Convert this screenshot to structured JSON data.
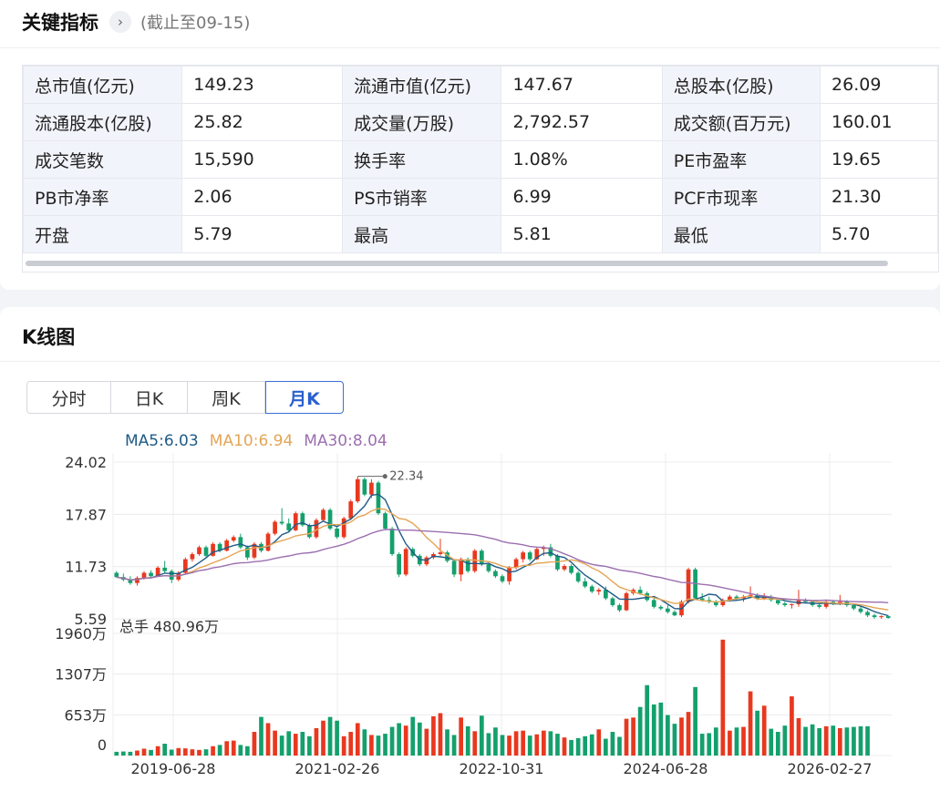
{
  "header": {
    "title": "关键指标",
    "subtitle": "(截止至09-15)"
  },
  "metrics": [
    [
      {
        "label": "总市值(亿元)",
        "value": "149.23"
      },
      {
        "label": "流通市值(亿元)",
        "value": "147.67"
      },
      {
        "label": "总股本(亿股)",
        "value": "26.09"
      }
    ],
    [
      {
        "label": "流通股本(亿股)",
        "value": "25.82"
      },
      {
        "label": "成交量(万股)",
        "value": "2,792.57"
      },
      {
        "label": "成交额(百万元)",
        "value": "160.01"
      }
    ],
    [
      {
        "label": "成交笔数",
        "value": "15,590"
      },
      {
        "label": "换手率",
        "value": "1.08%"
      },
      {
        "label": "PE市盈率",
        "value": "19.65"
      }
    ],
    [
      {
        "label": "PB市净率",
        "value": "2.06"
      },
      {
        "label": "PS市销率",
        "value": "6.99"
      },
      {
        "label": "PCF市现率",
        "value": "21.30"
      }
    ],
    [
      {
        "label": "开盘",
        "value": "5.79"
      },
      {
        "label": "最高",
        "value": "5.81"
      },
      {
        "label": "最低",
        "value": "5.70"
      }
    ]
  ],
  "kline": {
    "title": "K线图",
    "tabs": [
      "分时",
      "日K",
      "周K",
      "月K"
    ],
    "active_tab": "月K"
  },
  "colors": {
    "up": "#e8381f",
    "down": "#14a06c",
    "ma5": "#1f5b87",
    "ma10": "#e4a556",
    "ma30": "#9b6fb0",
    "accent": "#2a5fcf"
  },
  "chart_data": {
    "type": "candlestick",
    "ma_legend": [
      {
        "name": "MA5",
        "label": "MA5:6.03",
        "color": "#1f5b87"
      },
      {
        "name": "MA10",
        "label": "MA10:6.94",
        "color": "#e4a556"
      },
      {
        "name": "MA30",
        "label": "MA30:8.04",
        "color": "#9b6fb0"
      }
    ],
    "price_ticks": [
      "24.02",
      "17.87",
      "11.73",
      "5.59"
    ],
    "price_ylim": [
      5.59,
      24.02
    ],
    "volume_label": "总手 480.96万",
    "volume_ticks": [
      "1960万",
      "1307万",
      "653万",
      "0"
    ],
    "volume_ylim": [
      0,
      1960
    ],
    "x_ticks": [
      "2019-06-28",
      "2021-02-26",
      "2022-10-31",
      "2024-06-28",
      "2026-02-27"
    ],
    "max_annotation": "22.34",
    "ohlc": [
      [
        11.0,
        11.2,
        10.4,
        10.5
      ],
      [
        10.5,
        10.9,
        10.0,
        10.2
      ],
      [
        10.2,
        10.6,
        9.6,
        9.8
      ],
      [
        9.8,
        10.6,
        9.5,
        10.4
      ],
      [
        10.4,
        11.2,
        10.2,
        11.0
      ],
      [
        11.0,
        11.3,
        10.4,
        10.6
      ],
      [
        10.6,
        11.8,
        10.5,
        11.6
      ],
      [
        11.6,
        12.4,
        11.0,
        11.2
      ],
      [
        11.2,
        11.4,
        9.8,
        10.2
      ],
      [
        10.2,
        11.2,
        10.0,
        11.0
      ],
      [
        11.0,
        12.8,
        10.9,
        12.6
      ],
      [
        12.6,
        13.4,
        12.3,
        13.2
      ],
      [
        13.2,
        14.2,
        13.0,
        14.0
      ],
      [
        14.0,
        14.2,
        12.8,
        13.0
      ],
      [
        13.0,
        14.6,
        12.9,
        14.4
      ],
      [
        14.4,
        14.6,
        13.4,
        13.6
      ],
      [
        13.6,
        15.0,
        13.5,
        14.8
      ],
      [
        14.8,
        15.4,
        14.6,
        15.2
      ],
      [
        15.2,
        15.6,
        13.8,
        14.0
      ],
      [
        14.0,
        14.2,
        12.5,
        12.8
      ],
      [
        12.8,
        14.6,
        12.6,
        14.4
      ],
      [
        14.4,
        14.6,
        13.4,
        13.6
      ],
      [
        13.6,
        15.8,
        13.5,
        15.6
      ],
      [
        15.6,
        17.2,
        15.4,
        17.0
      ],
      [
        17.0,
        18.6,
        16.6,
        16.8
      ],
      [
        16.8,
        17.4,
        15.8,
        16.0
      ],
      [
        16.0,
        18.2,
        15.9,
        18.0
      ],
      [
        18.0,
        18.2,
        16.4,
        16.6
      ],
      [
        16.6,
        16.8,
        15.0,
        15.2
      ],
      [
        15.2,
        17.4,
        15.0,
        17.2
      ],
      [
        17.2,
        18.6,
        17.0,
        18.4
      ],
      [
        18.4,
        18.6,
        16.0,
        16.2
      ],
      [
        16.2,
        16.4,
        15.0,
        15.2
      ],
      [
        15.2,
        17.6,
        15.0,
        17.4
      ],
      [
        17.4,
        19.6,
        17.2,
        19.4
      ],
      [
        19.4,
        22.34,
        19.2,
        22.0
      ],
      [
        22.0,
        22.2,
        20.0,
        20.2
      ],
      [
        20.2,
        22.0,
        19.8,
        21.6
      ],
      [
        21.6,
        21.8,
        17.8,
        18.0
      ],
      [
        18.0,
        18.2,
        16.0,
        16.2
      ],
      [
        16.2,
        16.4,
        13.0,
        13.2
      ],
      [
        13.2,
        13.4,
        10.5,
        10.8
      ],
      [
        10.8,
        14.0,
        10.6,
        13.8
      ],
      [
        13.8,
        14.0,
        12.8,
        13.0
      ],
      [
        13.0,
        13.2,
        11.8,
        12.0
      ],
      [
        12.0,
        13.0,
        11.8,
        12.8
      ],
      [
        12.8,
        13.4,
        12.6,
        13.2
      ],
      [
        13.2,
        15.0,
        13.0,
        13.4
      ],
      [
        13.4,
        13.6,
        12.2,
        12.4
      ],
      [
        12.4,
        12.6,
        10.5,
        10.8
      ],
      [
        10.8,
        12.8,
        10.0,
        12.6
      ],
      [
        12.6,
        12.8,
        11.0,
        11.2
      ],
      [
        11.2,
        13.8,
        11.0,
        13.6
      ],
      [
        13.6,
        13.8,
        11.8,
        12.0
      ],
      [
        12.0,
        12.2,
        11.0,
        11.2
      ],
      [
        11.2,
        11.4,
        10.4,
        10.6
      ],
      [
        10.6,
        10.8,
        9.8,
        10.0
      ],
      [
        10.0,
        11.8,
        9.6,
        11.6
      ],
      [
        11.6,
        12.8,
        11.4,
        12.6
      ],
      [
        12.6,
        13.6,
        12.2,
        13.4
      ],
      [
        13.4,
        13.6,
        12.4,
        12.6
      ],
      [
        12.6,
        14.0,
        12.5,
        13.8
      ],
      [
        13.8,
        14.2,
        13.0,
        14.0
      ],
      [
        14.0,
        14.4,
        12.8,
        13.0
      ],
      [
        13.0,
        13.2,
        11.2,
        11.4
      ],
      [
        11.4,
        12.0,
        11.2,
        11.8
      ],
      [
        11.8,
        12.0,
        10.8,
        11.0
      ],
      [
        11.0,
        11.2,
        9.8,
        10.0
      ],
      [
        10.0,
        10.4,
        9.2,
        9.4
      ],
      [
        9.4,
        9.6,
        8.6,
        8.8
      ],
      [
        8.8,
        9.2,
        8.4,
        9.0
      ],
      [
        9.0,
        9.4,
        7.8,
        8.0
      ],
      [
        8.0,
        8.2,
        7.0,
        7.2
      ],
      [
        7.2,
        7.4,
        6.4,
        6.6
      ],
      [
        6.6,
        8.8,
        6.5,
        8.6
      ],
      [
        8.6,
        9.2,
        8.4,
        9.0
      ],
      [
        9.0,
        9.4,
        8.4,
        8.6
      ],
      [
        8.6,
        8.8,
        7.6,
        7.8
      ],
      [
        7.8,
        8.0,
        6.8,
        7.0
      ],
      [
        7.0,
        7.2,
        6.6,
        6.8
      ],
      [
        6.8,
        7.2,
        6.2,
        6.4
      ],
      [
        6.4,
        6.6,
        5.9,
        6.0
      ],
      [
        6.0,
        7.8,
        5.8,
        7.6
      ],
      [
        7.6,
        11.6,
        7.4,
        11.4
      ],
      [
        11.4,
        11.6,
        7.8,
        8.0
      ],
      [
        8.0,
        8.6,
        7.6,
        7.8
      ],
      [
        7.8,
        8.2,
        7.4,
        7.6
      ],
      [
        7.6,
        7.8,
        7.0,
        7.2
      ],
      [
        7.2,
        8.0,
        7.0,
        7.8
      ],
      [
        7.8,
        8.4,
        7.6,
        8.2
      ],
      [
        8.2,
        8.4,
        7.8,
        8.0
      ],
      [
        8.0,
        8.4,
        7.6,
        8.2
      ],
      [
        8.2,
        9.4,
        8.0,
        8.4
      ],
      [
        8.4,
        8.6,
        7.8,
        8.0
      ],
      [
        8.0,
        8.6,
        7.8,
        8.2
      ],
      [
        8.2,
        8.4,
        7.6,
        7.8
      ],
      [
        7.8,
        8.0,
        7.2,
        7.4
      ],
      [
        7.4,
        7.6,
        7.0,
        7.2
      ],
      [
        7.2,
        7.4,
        6.8,
        7.3
      ],
      [
        7.3,
        9.0,
        7.0,
        7.8
      ],
      [
        7.8,
        8.0,
        7.4,
        7.6
      ],
      [
        7.6,
        7.8,
        7.0,
        7.2
      ],
      [
        7.2,
        7.4,
        6.8,
        7.0
      ],
      [
        7.0,
        7.8,
        6.8,
        7.6
      ],
      [
        7.6,
        7.8,
        7.2,
        7.4
      ],
      [
        7.4,
        8.4,
        7.2,
        7.6
      ],
      [
        7.6,
        7.8,
        7.0,
        7.2
      ],
      [
        7.2,
        7.4,
        6.6,
        6.8
      ],
      [
        6.8,
        7.0,
        6.2,
        6.4
      ],
      [
        6.4,
        6.6,
        5.8,
        6.0
      ],
      [
        6.0,
        6.2,
        5.6,
        5.8
      ],
      [
        5.8,
        6.0,
        5.6,
        5.9
      ],
      [
        5.9,
        6.0,
        5.6,
        5.7
      ]
    ],
    "volume": [
      60,
      65,
      60,
      80,
      110,
      90,
      150,
      190,
      95,
      120,
      115,
      100,
      90,
      100,
      150,
      170,
      230,
      240,
      170,
      150,
      380,
      620,
      520,
      400,
      320,
      390,
      350,
      380,
      310,
      440,
      560,
      620,
      560,
      310,
      380,
      520,
      420,
      330,
      320,
      350,
      460,
      520,
      480,
      620,
      530,
      430,
      630,
      680,
      420,
      330,
      610,
      470,
      390,
      640,
      360,
      450,
      330,
      320,
      390,
      400,
      320,
      340,
      400,
      390,
      350,
      290,
      250,
      280,
      310,
      340,
      420,
      270,
      380,
      300,
      590,
      610,
      780,
      1130,
      820,
      850,
      650,
      510,
      610,
      700,
      1100,
      350,
      360,
      450,
      1860,
      400,
      450,
      460,
      1030,
      720,
      800,
      430,
      380,
      480,
      950,
      600,
      460,
      500,
      440,
      470,
      480,
      440,
      450,
      460,
      470,
      470
    ]
  }
}
